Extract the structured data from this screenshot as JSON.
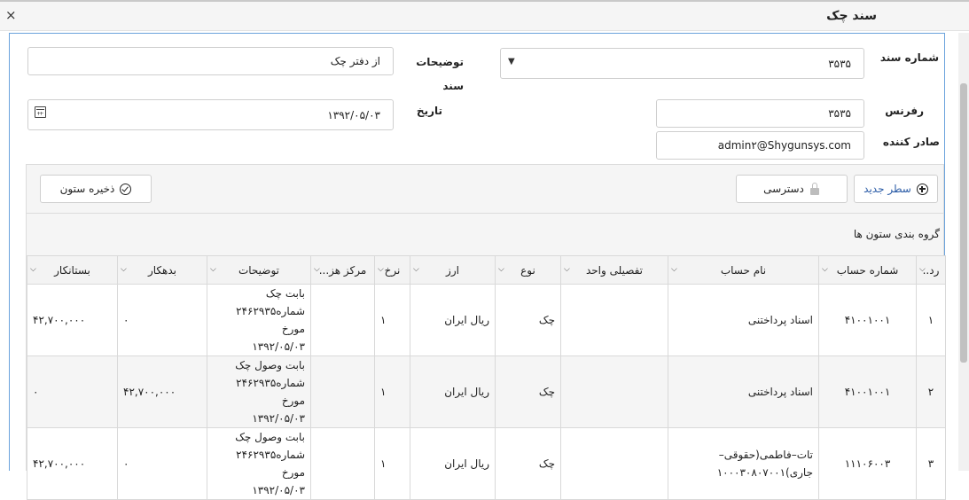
{
  "window": {
    "title": "سند چک",
    "close_glyph": "×"
  },
  "form": {
    "doc_number_label": "شماره سند",
    "doc_number_value": "۳۵۳۵",
    "reference_label": "رفرنس",
    "reference_value": "۳۵۳۵",
    "issuer_label": "صادر کننده",
    "issuer_value": "admin۲@Shygunsys.com",
    "description_label": "توضیحات سند",
    "description_value": "از دفتر چک",
    "date_label": "تاریخ",
    "date_value": "۱۳۹۲/۰۵/۰۳"
  },
  "toolbar": {
    "new_row_label": "سطر جدید",
    "access_label": "دسترسی",
    "save_columns_label": "ذخیره ستون"
  },
  "groupby_text": "گروه بندی ستون ها",
  "table": {
    "columns": [
      "رد..",
      "شماره حساب",
      "نام حساب",
      "تفصیلی واحد",
      "نوع",
      "ارز",
      "نرخ",
      "مرکز هز...",
      "توضیحات",
      "بدهکار",
      "بستانکار"
    ],
    "rows": [
      {
        "row": "۱",
        "account_no": "۴۱۰۰۱۰۰۱",
        "account_name": "اسناد پرداختنی",
        "unit": "",
        "type": "چک",
        "currency": "ریال ایران",
        "rate": "۱",
        "cost_center": "",
        "desc": [
          "بابت چک",
          "شماره۲۴۶۲۹۳۵ مورخ",
          "۱۳۹۲/۰۵/۰۳"
        ],
        "debit": "۰",
        "credit": "۴۲,۷۰۰,۰۰۰"
      },
      {
        "row": "۲",
        "account_no": "۴۱۰۰۱۰۰۱",
        "account_name": "اسناد پرداختنی",
        "unit": "",
        "type": "چک",
        "currency": "ریال ایران",
        "rate": "۱",
        "cost_center": "",
        "desc": [
          "بابت وصول چک",
          "شماره۲۴۶۲۹۳۵ مورخ",
          "۱۳۹۲/۰۵/۰۳"
        ],
        "debit": "۴۲,۷۰۰,۰۰۰",
        "credit": "۰"
      },
      {
        "row": "۳",
        "account_no": "۱۱۱۰۶۰۰۳",
        "account_name": "تات–فاطمی(حقوقی–جاری)۱۰۰۰۳۰۸۰۷۰۰۱",
        "unit": "",
        "type": "چک",
        "currency": "ریال ایران",
        "rate": "۱",
        "cost_center": "",
        "desc": [
          "بابت وصول چک",
          "شماره۲۴۶۲۹۳۵ مورخ",
          "۱۳۹۲/۰۵/۰۳"
        ],
        "debit": "۰",
        "credit": "۴۲,۷۰۰,۰۰۰"
      }
    ]
  },
  "colors": {
    "panel_border": "#6aa2dc",
    "link_blue": "#2a5ba6",
    "header_bg": "#f3f3f3",
    "alt_row": "#f5f5f5"
  }
}
